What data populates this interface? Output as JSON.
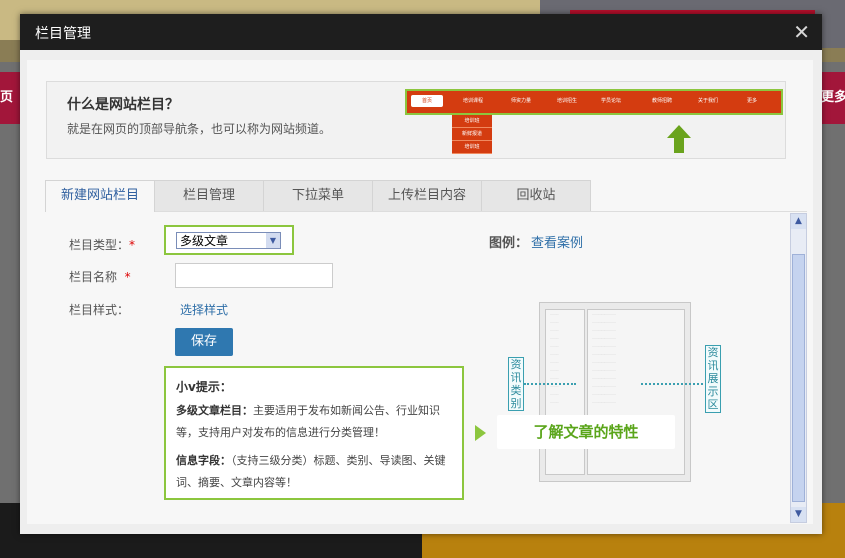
{
  "background": {
    "left_text": "页",
    "right_text": "更多"
  },
  "modal": {
    "title": "栏目管理",
    "close": "✕"
  },
  "intro": {
    "question": "什么是网站栏目？",
    "description": "就是在网页的顶部导航条，也可以称为网站频道。",
    "nav_demo": [
      "首页",
      "培训课程",
      "师资力量",
      "培训招生",
      "学员论坛",
      "教师招聘",
      "关于我们",
      "更多"
    ],
    "dropdown_demo": [
      "培训班",
      "新鲜报道",
      "培训班"
    ]
  },
  "tabs": [
    "新建网站栏目",
    "栏目管理",
    "下拉菜单",
    "上传栏目内容",
    "回收站"
  ],
  "form": {
    "type_label": "栏目类型：",
    "type_value": "多级文章",
    "name_label": "栏目名称",
    "style_label": "栏目样式：",
    "style_link": "选择样式",
    "save_label": "保存",
    "required_mark": "*"
  },
  "example": {
    "label": "图例：",
    "link": "查看案例"
  },
  "tip": {
    "title": "小v提示：",
    "p1_bold": "多级文章栏目：",
    "p1_text": "主要适用于发布如新闻公告、行业知识等，支持用户对发布的信息进行分类管理！",
    "p2_bold": "信息字段：",
    "p2_text": "（支持三级分类）标题、类别、导读图、关键词、摘要、文章内容等！"
  },
  "preview": {
    "left_label": "资讯类别",
    "right_label": "资讯展示区",
    "callout": "了解文章的特性"
  },
  "colors": {
    "accent_green": "#8cc63e",
    "nav_red": "#d43c10",
    "link_blue": "#2f6fa8",
    "button_blue": "#2f78b0"
  }
}
